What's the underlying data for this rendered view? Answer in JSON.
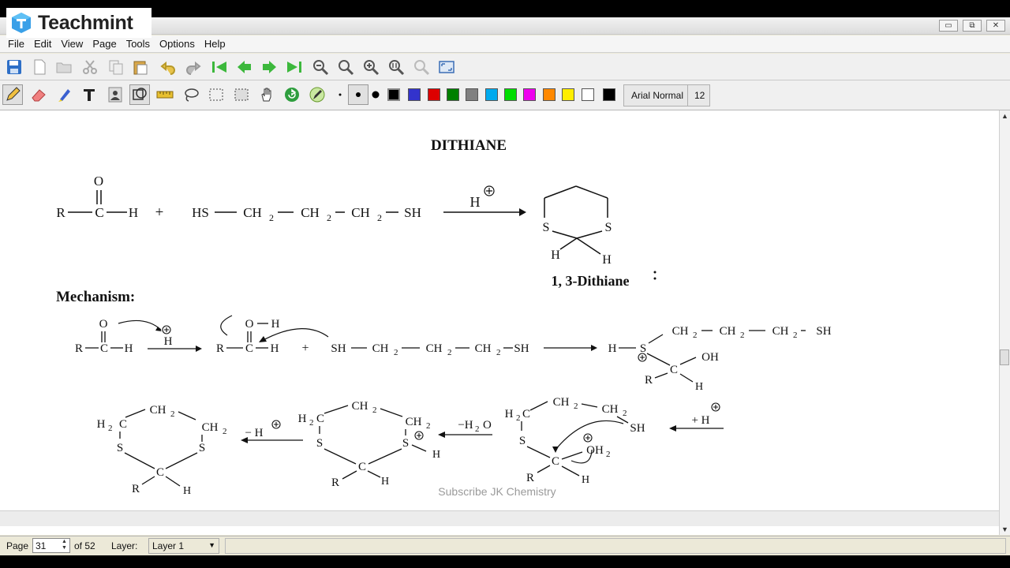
{
  "brand": {
    "name": "Teachmint"
  },
  "window": {
    "minimize": "▭",
    "restore": "⧉",
    "close": "✕"
  },
  "menu": [
    "File",
    "Edit",
    "View",
    "Page",
    "Tools",
    "Options",
    "Help"
  ],
  "toolbar1_icons": [
    "save-icon",
    "new-page-icon",
    "open-icon",
    "cut-icon",
    "copy-icon",
    "paste-icon",
    "undo-icon",
    "redo-icon",
    "first-page-icon",
    "previous-page-icon",
    "next-page-icon",
    "last-page-icon",
    "zoom-out-icon",
    "zoom-fit-width-icon",
    "zoom-in-icon",
    "zoom-actual-icon",
    "zoom-region-icon",
    "fullscreen-icon"
  ],
  "toolbar2_icons": [
    "pen-icon",
    "eraser-icon",
    "highlighter-icon",
    "text-icon",
    "image-icon",
    "shape-icon",
    "ruler-icon",
    "lasso-icon",
    "select-rect-icon",
    "select-region-icon",
    "hand-icon",
    "refresh-icon",
    "pen-settings-icon"
  ],
  "palette": [
    "#000000",
    "#3333cc",
    "#dd0000",
    "#008000",
    "#808080",
    "#00aaee",
    "#00dd00",
    "#ee00ee",
    "#ff8800",
    "#ffee00",
    "#ffffff",
    "#000000"
  ],
  "font": {
    "name": "Arial Normal",
    "size": "12"
  },
  "document": {
    "title": "DITHIANE",
    "reaction": {
      "o_atom": "O",
      "r": "R",
      "c": "C",
      "h": "H",
      "plus": "+",
      "thiol": "HS",
      "ch2": "CH",
      "sub2": "2",
      "sh": "SH",
      "catalyst": "H",
      "ring_s": "S",
      "product_name": "1, 3-Dithiane"
    },
    "mechanism_label": "Mechanism:",
    "minus_h2o": "−H",
    "oh": "OH",
    "oh2": "OH",
    "h2c": "H",
    "minus_h": "− H",
    "plus_h": "+ H",
    "watermark": "Subscribe JK Chemistry"
  },
  "status": {
    "page_label": "Page",
    "page_value": "31",
    "of_label": "of 52",
    "layer_label": "Layer:",
    "layer_value": "Layer 1"
  }
}
